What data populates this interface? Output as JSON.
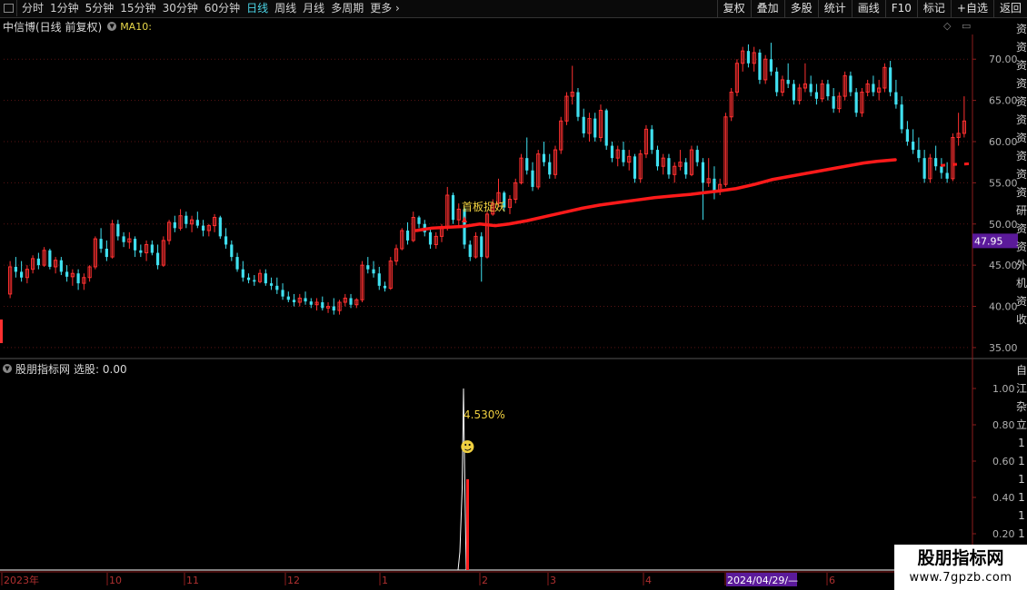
{
  "toolbar": {
    "periods": [
      "分时",
      "1分钟",
      "5分钟",
      "15分钟",
      "30分钟",
      "60分钟",
      "日线",
      "周线",
      "月线",
      "多周期",
      "更多"
    ],
    "active_period": "日线",
    "actions": [
      "复权",
      "叠加",
      "多股",
      "统计",
      "画线",
      "F10",
      "标记",
      "+自选",
      "返回"
    ]
  },
  "main_title": {
    "stock": "中信博(日线 前复权)",
    "indicator": "MA10:"
  },
  "price_axis": {
    "ticks": [
      "70.00",
      "65.00",
      "60.00",
      "55.00",
      "50.00",
      "45.00",
      "40.00",
      "35.00"
    ],
    "current_price": "47.95"
  },
  "signal": {
    "label": "首板捉妖"
  },
  "indicator_panel": {
    "name": "股朋指标网",
    "value_label": "选股: 0.00",
    "ticks": [
      "1.00",
      "0.80",
      "0.60",
      "0.40",
      "0.20"
    ],
    "percent_label": "4.530%",
    "smiley": "☻"
  },
  "time_axis": {
    "labels": [
      "2023年",
      "10",
      "11",
      "12",
      "1",
      "2",
      "3",
      "4",
      "2024/04/29/—",
      "6"
    ]
  },
  "side_text_main": [
    "资",
    "资",
    "资",
    "资",
    "资",
    "资",
    "资",
    "资",
    "资",
    "资",
    "研",
    "资",
    "资",
    "外",
    "机",
    "资",
    "收"
  ],
  "side_text_ind": [
    "自",
    "江",
    "杂",
    "立",
    "1",
    "1",
    "1",
    "1",
    "1",
    "1",
    "1"
  ],
  "watermark": {
    "title": "股朋指标网",
    "url": "www.7gpzb.com"
  },
  "colors": {
    "up": "#ff3030",
    "down": "#40e0f0",
    "ma": "#ff1a1a",
    "axis": "#8b1c1c",
    "highlight": "#5b1a9a"
  },
  "chart_data": {
    "type": "candlestick",
    "ylim": [
      34,
      73
    ],
    "candles": [
      {
        "o": 41.5,
        "h": 45.5,
        "l": 41.0,
        "c": 44.8
      },
      {
        "o": 44.8,
        "h": 46.0,
        "l": 43.5,
        "c": 44.2
      },
      {
        "o": 44.2,
        "h": 45.5,
        "l": 43.0,
        "c": 43.5
      },
      {
        "o": 43.5,
        "h": 45.0,
        "l": 42.8,
        "c": 44.5
      },
      {
        "o": 44.5,
        "h": 46.2,
        "l": 44.0,
        "c": 45.8
      },
      {
        "o": 45.8,
        "h": 46.5,
        "l": 44.5,
        "c": 45.0
      },
      {
        "o": 45.0,
        "h": 47.2,
        "l": 44.8,
        "c": 46.8
      },
      {
        "o": 46.8,
        "h": 47.0,
        "l": 44.5,
        "c": 44.8
      },
      {
        "o": 44.8,
        "h": 46.0,
        "l": 44.0,
        "c": 45.6
      },
      {
        "o": 45.6,
        "h": 46.0,
        "l": 43.8,
        "c": 44.2
      },
      {
        "o": 44.2,
        "h": 45.0,
        "l": 43.0,
        "c": 43.6
      },
      {
        "o": 43.6,
        "h": 44.5,
        "l": 42.5,
        "c": 44.0
      },
      {
        "o": 44.0,
        "h": 44.5,
        "l": 42.0,
        "c": 42.8
      },
      {
        "o": 42.8,
        "h": 44.0,
        "l": 42.0,
        "c": 43.5
      },
      {
        "o": 43.5,
        "h": 45.0,
        "l": 43.0,
        "c": 44.8
      },
      {
        "o": 44.8,
        "h": 48.5,
        "l": 44.5,
        "c": 48.2
      },
      {
        "o": 48.2,
        "h": 49.5,
        "l": 46.5,
        "c": 47.0
      },
      {
        "o": 47.0,
        "h": 48.0,
        "l": 45.5,
        "c": 46.0
      },
      {
        "o": 46.0,
        "h": 50.5,
        "l": 45.8,
        "c": 50.0
      },
      {
        "o": 50.0,
        "h": 50.5,
        "l": 48.0,
        "c": 48.5
      },
      {
        "o": 48.5,
        "h": 49.0,
        "l": 47.2,
        "c": 47.8
      },
      {
        "o": 47.8,
        "h": 49.0,
        "l": 47.0,
        "c": 48.2
      },
      {
        "o": 48.2,
        "h": 48.5,
        "l": 46.0,
        "c": 46.8
      },
      {
        "o": 46.8,
        "h": 47.5,
        "l": 46.0,
        "c": 46.5
      },
      {
        "o": 46.5,
        "h": 48.0,
        "l": 45.5,
        "c": 47.5
      },
      {
        "o": 47.5,
        "h": 48.0,
        "l": 46.2,
        "c": 46.5
      },
      {
        "o": 46.5,
        "h": 47.5,
        "l": 44.5,
        "c": 45.0
      },
      {
        "o": 45.0,
        "h": 48.5,
        "l": 44.8,
        "c": 48.0
      },
      {
        "o": 48.0,
        "h": 50.5,
        "l": 47.5,
        "c": 50.2
      },
      {
        "o": 50.2,
        "h": 51.0,
        "l": 49.0,
        "c": 49.5
      },
      {
        "o": 49.5,
        "h": 51.8,
        "l": 49.2,
        "c": 51.0
      },
      {
        "o": 51.0,
        "h": 51.5,
        "l": 49.5,
        "c": 50.0
      },
      {
        "o": 50.0,
        "h": 51.0,
        "l": 49.0,
        "c": 50.5
      },
      {
        "o": 50.5,
        "h": 51.5,
        "l": 49.5,
        "c": 49.8
      },
      {
        "o": 49.8,
        "h": 50.5,
        "l": 48.5,
        "c": 49.2
      },
      {
        "o": 49.2,
        "h": 50.0,
        "l": 48.5,
        "c": 49.8
      },
      {
        "o": 49.8,
        "h": 51.2,
        "l": 49.0,
        "c": 50.8
      },
      {
        "o": 50.8,
        "h": 51.0,
        "l": 48.2,
        "c": 48.5
      },
      {
        "o": 48.5,
        "h": 49.5,
        "l": 47.0,
        "c": 47.5
      },
      {
        "o": 47.5,
        "h": 48.0,
        "l": 45.5,
        "c": 46.0
      },
      {
        "o": 46.0,
        "h": 46.5,
        "l": 44.2,
        "c": 44.5
      },
      {
        "o": 44.5,
        "h": 45.5,
        "l": 43.0,
        "c": 43.5
      },
      {
        "o": 43.5,
        "h": 44.0,
        "l": 42.8,
        "c": 43.2
      },
      {
        "o": 43.2,
        "h": 43.8,
        "l": 42.5,
        "c": 43.0
      },
      {
        "o": 43.0,
        "h": 44.5,
        "l": 42.8,
        "c": 44.0
      },
      {
        "o": 44.0,
        "h": 44.5,
        "l": 42.5,
        "c": 42.8
      },
      {
        "o": 42.8,
        "h": 43.5,
        "l": 42.0,
        "c": 42.5
      },
      {
        "o": 42.5,
        "h": 43.5,
        "l": 41.5,
        "c": 42.0
      },
      {
        "o": 42.0,
        "h": 42.8,
        "l": 40.8,
        "c": 41.2
      },
      {
        "o": 41.2,
        "h": 41.8,
        "l": 40.5,
        "c": 40.8
      },
      {
        "o": 40.8,
        "h": 41.5,
        "l": 40.0,
        "c": 40.5
      },
      {
        "o": 40.5,
        "h": 41.5,
        "l": 40.0,
        "c": 41.0
      },
      {
        "o": 41.0,
        "h": 41.8,
        "l": 40.2,
        "c": 40.6
      },
      {
        "o": 40.6,
        "h": 41.0,
        "l": 39.8,
        "c": 40.2
      },
      {
        "o": 40.2,
        "h": 41.0,
        "l": 39.5,
        "c": 40.5
      },
      {
        "o": 40.5,
        "h": 41.2,
        "l": 39.5,
        "c": 39.8
      },
      {
        "o": 39.8,
        "h": 40.5,
        "l": 39.2,
        "c": 40.0
      },
      {
        "o": 40.0,
        "h": 41.0,
        "l": 39.0,
        "c": 39.5
      },
      {
        "o": 39.5,
        "h": 40.8,
        "l": 39.0,
        "c": 40.5
      },
      {
        "o": 40.5,
        "h": 41.5,
        "l": 40.0,
        "c": 41.0
      },
      {
        "o": 41.0,
        "h": 41.5,
        "l": 39.8,
        "c": 40.2
      },
      {
        "o": 40.2,
        "h": 41.0,
        "l": 39.8,
        "c": 40.8
      },
      {
        "o": 40.8,
        "h": 45.5,
        "l": 40.5,
        "c": 45.0
      },
      {
        "o": 45.0,
        "h": 46.0,
        "l": 44.0,
        "c": 44.5
      },
      {
        "o": 44.5,
        "h": 45.5,
        "l": 43.5,
        "c": 44.0
      },
      {
        "o": 44.0,
        "h": 44.8,
        "l": 42.0,
        "c": 42.5
      },
      {
        "o": 42.5,
        "h": 43.0,
        "l": 41.8,
        "c": 42.2
      },
      {
        "o": 42.2,
        "h": 46.0,
        "l": 42.0,
        "c": 45.5
      },
      {
        "o": 45.5,
        "h": 47.5,
        "l": 45.0,
        "c": 47.0
      },
      {
        "o": 47.0,
        "h": 49.5,
        "l": 46.8,
        "c": 49.2
      },
      {
        "o": 49.2,
        "h": 50.2,
        "l": 47.5,
        "c": 48.0
      },
      {
        "o": 48.0,
        "h": 51.5,
        "l": 47.8,
        "c": 50.8
      },
      {
        "o": 50.8,
        "h": 51.0,
        "l": 49.5,
        "c": 50.0
      },
      {
        "o": 50.0,
        "h": 50.5,
        "l": 48.5,
        "c": 49.0
      },
      {
        "o": 49.0,
        "h": 49.5,
        "l": 47.0,
        "c": 47.5
      },
      {
        "o": 47.5,
        "h": 49.0,
        "l": 47.0,
        "c": 48.5
      },
      {
        "o": 48.5,
        "h": 50.0,
        "l": 47.8,
        "c": 49.5
      },
      {
        "o": 49.5,
        "h": 54.5,
        "l": 49.2,
        "c": 53.5
      },
      {
        "o": 53.5,
        "h": 53.8,
        "l": 50.0,
        "c": 50.5
      },
      {
        "o": 50.5,
        "h": 52.5,
        "l": 49.5,
        "c": 51.8
      },
      {
        "o": 51.8,
        "h": 52.0,
        "l": 47.0,
        "c": 47.5
      },
      {
        "o": 47.5,
        "h": 48.0,
        "l": 45.5,
        "c": 46.0
      },
      {
        "o": 46.0,
        "h": 49.0,
        "l": 45.8,
        "c": 48.5
      },
      {
        "o": 48.5,
        "h": 49.0,
        "l": 43.0,
        "c": 46.0
      },
      {
        "o": 46.0,
        "h": 51.5,
        "l": 45.8,
        "c": 51.2
      },
      {
        "o": 51.2,
        "h": 53.0,
        "l": 51.0,
        "c": 52.5
      },
      {
        "o": 52.5,
        "h": 55.5,
        "l": 52.0,
        "c": 53.8
      },
      {
        "o": 53.8,
        "h": 54.0,
        "l": 51.5,
        "c": 52.0
      },
      {
        "o": 52.0,
        "h": 53.5,
        "l": 51.2,
        "c": 53.0
      },
      {
        "o": 53.0,
        "h": 55.5,
        "l": 52.5,
        "c": 55.0
      },
      {
        "o": 55.0,
        "h": 58.5,
        "l": 54.8,
        "c": 58.0
      },
      {
        "o": 58.0,
        "h": 60.5,
        "l": 56.0,
        "c": 56.5
      },
      {
        "o": 56.5,
        "h": 57.5,
        "l": 54.0,
        "c": 54.5
      },
      {
        "o": 54.5,
        "h": 59.0,
        "l": 54.2,
        "c": 58.5
      },
      {
        "o": 58.5,
        "h": 60.0,
        "l": 57.0,
        "c": 57.5
      },
      {
        "o": 57.5,
        "h": 58.5,
        "l": 55.5,
        "c": 56.0
      },
      {
        "o": 56.0,
        "h": 59.5,
        "l": 55.5,
        "c": 59.0
      },
      {
        "o": 59.0,
        "h": 63.0,
        "l": 58.5,
        "c": 62.5
      },
      {
        "o": 62.5,
        "h": 66.0,
        "l": 62.0,
        "c": 65.5
      },
      {
        "o": 65.5,
        "h": 69.2,
        "l": 64.5,
        "c": 66.0
      },
      {
        "o": 66.0,
        "h": 66.5,
        "l": 62.5,
        "c": 63.0
      },
      {
        "o": 63.0,
        "h": 64.0,
        "l": 60.5,
        "c": 61.0
      },
      {
        "o": 61.0,
        "h": 63.5,
        "l": 60.0,
        "c": 62.8
      },
      {
        "o": 62.8,
        "h": 63.5,
        "l": 60.0,
        "c": 60.5
      },
      {
        "o": 60.5,
        "h": 64.5,
        "l": 60.0,
        "c": 63.8
      },
      {
        "o": 63.8,
        "h": 64.0,
        "l": 59.0,
        "c": 59.5
      },
      {
        "o": 59.5,
        "h": 60.0,
        "l": 57.5,
        "c": 58.0
      },
      {
        "o": 58.0,
        "h": 59.5,
        "l": 57.0,
        "c": 59.0
      },
      {
        "o": 59.0,
        "h": 60.0,
        "l": 57.0,
        "c": 57.5
      },
      {
        "o": 57.5,
        "h": 59.0,
        "l": 56.5,
        "c": 58.2
      },
      {
        "o": 58.2,
        "h": 58.5,
        "l": 55.0,
        "c": 55.5
      },
      {
        "o": 55.5,
        "h": 59.0,
        "l": 55.0,
        "c": 58.5
      },
      {
        "o": 58.5,
        "h": 62.0,
        "l": 58.0,
        "c": 61.5
      },
      {
        "o": 61.5,
        "h": 62.0,
        "l": 58.5,
        "c": 59.0
      },
      {
        "o": 59.0,
        "h": 59.5,
        "l": 56.5,
        "c": 57.0
      },
      {
        "o": 57.0,
        "h": 58.5,
        "l": 56.0,
        "c": 58.0
      },
      {
        "o": 58.0,
        "h": 58.5,
        "l": 55.5,
        "c": 56.0
      },
      {
        "o": 56.0,
        "h": 57.5,
        "l": 55.0,
        "c": 57.0
      },
      {
        "o": 57.0,
        "h": 59.0,
        "l": 56.5,
        "c": 57.5
      },
      {
        "o": 57.5,
        "h": 58.0,
        "l": 55.5,
        "c": 56.0
      },
      {
        "o": 56.0,
        "h": 59.5,
        "l": 55.8,
        "c": 59.0
      },
      {
        "o": 59.0,
        "h": 59.5,
        "l": 57.0,
        "c": 57.5
      },
      {
        "o": 57.5,
        "h": 58.0,
        "l": 50.5,
        "c": 55.0
      },
      {
        "o": 55.0,
        "h": 58.0,
        "l": 54.5,
        "c": 55.5
      },
      {
        "o": 55.5,
        "h": 57.0,
        "l": 53.0,
        "c": 54.0
      },
      {
        "o": 54.0,
        "h": 55.5,
        "l": 53.5,
        "c": 54.8
      },
      {
        "o": 54.8,
        "h": 63.5,
        "l": 54.5,
        "c": 63.0
      },
      {
        "o": 63.0,
        "h": 66.5,
        "l": 62.5,
        "c": 66.0
      },
      {
        "o": 66.0,
        "h": 70.0,
        "l": 65.5,
        "c": 69.5
      },
      {
        "o": 69.5,
        "h": 71.5,
        "l": 68.5,
        "c": 71.0
      },
      {
        "o": 71.0,
        "h": 71.8,
        "l": 69.0,
        "c": 69.5
      },
      {
        "o": 69.5,
        "h": 71.5,
        "l": 68.5,
        "c": 70.8
      },
      {
        "o": 70.8,
        "h": 71.2,
        "l": 67.0,
        "c": 67.5
      },
      {
        "o": 67.5,
        "h": 70.5,
        "l": 67.0,
        "c": 70.0
      },
      {
        "o": 70.0,
        "h": 72.0,
        "l": 68.0,
        "c": 68.5
      },
      {
        "o": 68.5,
        "h": 69.0,
        "l": 65.5,
        "c": 66.0
      },
      {
        "o": 66.0,
        "h": 68.0,
        "l": 65.5,
        "c": 67.5
      },
      {
        "o": 67.5,
        "h": 69.5,
        "l": 66.5,
        "c": 67.0
      },
      {
        "o": 67.0,
        "h": 67.5,
        "l": 64.5,
        "c": 65.0
      },
      {
        "o": 65.0,
        "h": 67.0,
        "l": 64.5,
        "c": 66.5
      },
      {
        "o": 66.5,
        "h": 69.5,
        "l": 66.0,
        "c": 67.0
      },
      {
        "o": 67.0,
        "h": 68.0,
        "l": 65.5,
        "c": 66.0
      },
      {
        "o": 66.0,
        "h": 67.0,
        "l": 64.5,
        "c": 65.2
      },
      {
        "o": 65.2,
        "h": 67.5,
        "l": 64.8,
        "c": 67.0
      },
      {
        "o": 67.0,
        "h": 67.5,
        "l": 65.0,
        "c": 65.5
      },
      {
        "o": 65.5,
        "h": 66.5,
        "l": 63.5,
        "c": 64.0
      },
      {
        "o": 64.0,
        "h": 66.0,
        "l": 63.5,
        "c": 65.5
      },
      {
        "o": 65.5,
        "h": 68.5,
        "l": 65.0,
        "c": 68.0
      },
      {
        "o": 68.0,
        "h": 68.5,
        "l": 65.5,
        "c": 66.0
      },
      {
        "o": 66.0,
        "h": 66.5,
        "l": 63.0,
        "c": 63.5
      },
      {
        "o": 63.5,
        "h": 66.5,
        "l": 63.0,
        "c": 66.0
      },
      {
        "o": 66.0,
        "h": 67.5,
        "l": 65.5,
        "c": 67.0
      },
      {
        "o": 67.0,
        "h": 68.0,
        "l": 65.5,
        "c": 66.0
      },
      {
        "o": 66.0,
        "h": 67.5,
        "l": 65.0,
        "c": 66.5
      },
      {
        "o": 66.5,
        "h": 69.5,
        "l": 66.0,
        "c": 69.0
      },
      {
        "o": 69.0,
        "h": 69.8,
        "l": 65.5,
        "c": 66.0
      },
      {
        "o": 66.0,
        "h": 67.5,
        "l": 64.0,
        "c": 64.5
      },
      {
        "o": 64.5,
        "h": 65.5,
        "l": 61.0,
        "c": 61.5
      },
      {
        "o": 61.5,
        "h": 62.5,
        "l": 59.5,
        "c": 60.0
      },
      {
        "o": 60.0,
        "h": 61.5,
        "l": 58.5,
        "c": 59.0
      },
      {
        "o": 59.0,
        "h": 60.5,
        "l": 57.5,
        "c": 58.0
      },
      {
        "o": 58.0,
        "h": 59.0,
        "l": 55.0,
        "c": 55.5
      },
      {
        "o": 55.5,
        "h": 58.5,
        "l": 55.0,
        "c": 58.0
      },
      {
        "o": 58.0,
        "h": 59.5,
        "l": 56.5,
        "c": 57.0
      },
      {
        "o": 57.0,
        "h": 58.0,
        "l": 55.5,
        "c": 56.2
      },
      {
        "o": 56.2,
        "h": 57.5,
        "l": 55.0,
        "c": 55.5
      },
      {
        "o": 55.5,
        "h": 61.0,
        "l": 55.2,
        "c": 60.5
      },
      {
        "o": 60.5,
        "h": 63.5,
        "l": 59.5,
        "c": 61.0
      },
      {
        "o": 61.0,
        "h": 65.5,
        "l": 60.5,
        "c": 62.5
      }
    ],
    "ma10": [
      [
        458,
        49.2
      ],
      [
        475,
        49.5
      ],
      [
        492,
        49.6
      ],
      [
        510,
        49.7
      ],
      [
        528,
        50.0
      ],
      [
        545,
        49.8
      ],
      [
        560,
        50.0
      ],
      [
        580,
        50.4
      ],
      [
        600,
        50.9
      ],
      [
        620,
        51.4
      ],
      [
        640,
        51.9
      ],
      [
        660,
        52.3
      ],
      [
        680,
        52.6
      ],
      [
        700,
        52.9
      ],
      [
        720,
        53.2
      ],
      [
        740,
        53.4
      ],
      [
        760,
        53.6
      ],
      [
        775,
        53.8
      ],
      [
        790,
        54.0
      ],
      [
        810,
        54.3
      ],
      [
        830,
        54.8
      ],
      [
        850,
        55.4
      ],
      [
        870,
        55.8
      ],
      [
        890,
        56.2
      ],
      [
        910,
        56.6
      ],
      [
        930,
        57.0
      ],
      [
        950,
        57.4
      ],
      [
        965,
        57.6
      ],
      [
        985,
        57.8
      ]
    ],
    "ma10_tail": [
      [
        1035,
        57.1
      ],
      [
        1045,
        57.2
      ],
      [
        1065,
        57.3
      ],
      [
        1072,
        57.3
      ]
    ],
    "signal": {
      "x": 511,
      "price": 50.2
    },
    "indicator": {
      "ylim": [
        0,
        1.05
      ],
      "white_bar": {
        "x": 510,
        "value": 1.0
      },
      "red_bar": {
        "x": 514,
        "value": 0.5
      }
    }
  }
}
